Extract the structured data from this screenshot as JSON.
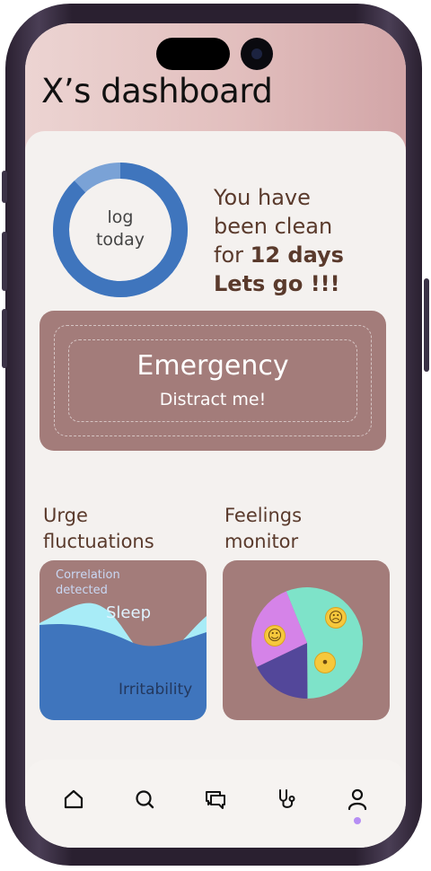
{
  "header": {
    "title": "X’s dashboard"
  },
  "progress": {
    "ring_label_line1": "log",
    "ring_label_line2": "today",
    "ring_fill_fraction": 0.88,
    "message_line1": "You have",
    "message_line2": "been clean",
    "message_line3_prefix": "for ",
    "message_days": "12 days",
    "message_line4": "Lets go !!!"
  },
  "emergency": {
    "title": "Emergency",
    "subtitle": "Distract me!"
  },
  "urge": {
    "title_line1": "Urge",
    "title_line2": "fluctuations",
    "correlation_line1": "Correlation",
    "correlation_line2": "detected",
    "series_top": "Sleep",
    "series_bottom": "Irritability"
  },
  "feelings": {
    "title_line1": "Feelings",
    "title_line2": "monitor",
    "slices": [
      {
        "mood": "happy",
        "share": 0.56,
        "color": "#7ee3c9"
      },
      {
        "mood": "sad",
        "share": 0.18,
        "color": "#53479a"
      },
      {
        "mood": "neutral",
        "share": 0.26,
        "color": "#d583e8"
      }
    ]
  },
  "nav": {
    "items": [
      "home-icon",
      "search-icon",
      "chat-icon",
      "stethoscope-icon",
      "profile-icon"
    ],
    "active": "profile-icon"
  },
  "colors": {
    "brand_rose": "#a37c7a",
    "ring_blue": "#3f75bd",
    "text_brown": "#5a3a2c",
    "active_dot": "#b68ef4"
  }
}
